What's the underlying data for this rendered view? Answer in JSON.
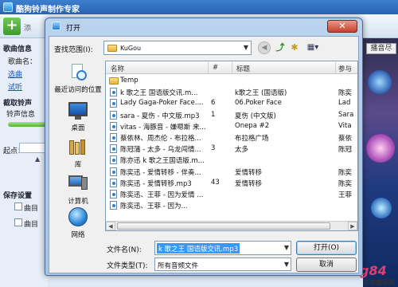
{
  "app": {
    "title": "酷狗铃声制作专家",
    "toolbar_add_label": "添",
    "left_labels": {
      "song_info": "歌曲信息",
      "song_name": "歌曲名：",
      "link1": "选曲",
      "link2": "试听",
      "cut_ringtone": "截取铃声",
      "ringtone_info": "铃声信息",
      "start": "起点：",
      "save_settings": "保存设置",
      "opt1": "曲目",
      "opt2": "曲目"
    },
    "right_button": "播音尽",
    "watermark": "g84",
    "watermark_sub": "连用教程网"
  },
  "dialog": {
    "title": "打开",
    "close_glyph": "✕",
    "look_in_label": "查找范围(I):",
    "look_in_value": "KuGou",
    "places": [
      {
        "label": "最近访问的位置",
        "icon": "recent-places-icon"
      },
      {
        "label": "桌面",
        "icon": "desktop-icon"
      },
      {
        "label": "库",
        "icon": "libraries-icon"
      },
      {
        "label": "计算机",
        "icon": "computer-icon"
      },
      {
        "label": "网络",
        "icon": "network-icon"
      }
    ],
    "columns": {
      "name": "名称",
      "num": "#",
      "title": "标题",
      "artist": "参与"
    },
    "files": [
      {
        "name": "Temp",
        "num": "",
        "title": "",
        "artist": "",
        "type": "folder"
      },
      {
        "name": "k 歌之王 国语版交讯.m...",
        "num": "",
        "title": "k歌之王 (国语版)",
        "artist": "陈奕",
        "type": "file"
      },
      {
        "name": "Lady Gaga-Poker Face....",
        "num": "6",
        "title": "06.Poker Face",
        "artist": "Lad",
        "type": "file"
      },
      {
        "name": "sara - 夏伤 - 中文版.mp3",
        "num": "1",
        "title": "夏伤 (中文版)",
        "artist": "Sara",
        "type": "file"
      },
      {
        "name": "vitas - 海豚音 - 嫌嗯斯 来...",
        "num": "",
        "title": "Onepa #2",
        "artist": "Vita",
        "type": "file"
      },
      {
        "name": "蔡依林、周杰伦 - 布拉格...",
        "num": "",
        "title": "布拉格广场",
        "artist": "蔡依",
        "type": "file"
      },
      {
        "name": "陈冠蒲 - 太多 - 乌龙闯情...",
        "num": "3",
        "title": "太多",
        "artist": "陈冠",
        "type": "file"
      },
      {
        "name": "陈亦迅 k 歌之王国语版.m...",
        "num": "",
        "title": "",
        "artist": "",
        "type": "file"
      },
      {
        "name": "陈奕迅 - 爱情转移 - 伴奏...",
        "num": "",
        "title": "爱情转移",
        "artist": "陈奕",
        "type": "file"
      },
      {
        "name": "陈奕迅 - 爱情转移.mp3",
        "num": "43",
        "title": "爱情转移",
        "artist": "陈奕",
        "type": "file"
      },
      {
        "name": "陈奕迅、王菲 - 因为爱情 ...",
        "num": "",
        "title": "",
        "artist": "王菲",
        "type": "file"
      },
      {
        "name": "陈奕迅、王菲 - 因为...",
        "num": "",
        "title": "",
        "artist": "",
        "type": "file"
      }
    ],
    "file_name_label": "文件名(N):",
    "file_name_value": "k 歌之王 国语版交讯.mp3",
    "file_type_label": "文件类型(T):",
    "file_type_value": "所有音频文件",
    "open_button": "打开(O)",
    "cancel_button": "取消"
  }
}
